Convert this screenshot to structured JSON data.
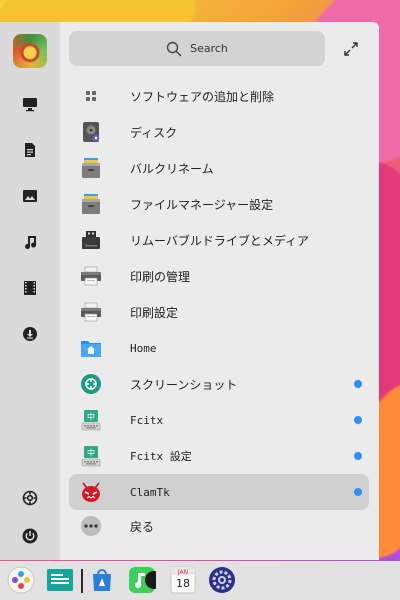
{
  "search": {
    "label": "Search"
  },
  "sidebar": {
    "icons": [
      "computer-icon",
      "document-icon",
      "picture-icon",
      "music-icon",
      "video-icon",
      "download-icon",
      "settings-icon",
      "power-icon"
    ]
  },
  "apps": [
    {
      "label": "ソフトウェアの追加と削除",
      "icon": "package-grid-icon",
      "mono": false,
      "dot": false
    },
    {
      "label": "ディスク",
      "icon": "disk-icon",
      "mono": false,
      "dot": false
    },
    {
      "label": "バルクリネーム",
      "icon": "file-cabinet-icon",
      "mono": false,
      "dot": false
    },
    {
      "label": "ファイルマネージャー設定",
      "icon": "file-cabinet-icon",
      "mono": false,
      "dot": false
    },
    {
      "label": "リムーバブルドライブとメディア",
      "icon": "removable-drive-icon",
      "mono": false,
      "dot": false
    },
    {
      "label": "印刷の管理",
      "icon": "printer-icon",
      "mono": false,
      "dot": false
    },
    {
      "label": "印刷設定",
      "icon": "printer-icon",
      "mono": false,
      "dot": false
    },
    {
      "label": "Home",
      "icon": "home-folder-icon",
      "mono": true,
      "dot": false
    },
    {
      "label": "スクリーンショット",
      "icon": "screenshot-icon",
      "mono": false,
      "dot": true
    },
    {
      "label": "Fcitx",
      "icon": "keyboard-input-icon",
      "mono": true,
      "dot": true
    },
    {
      "label": "Fcitx 設定",
      "icon": "keyboard-input-icon",
      "mono": true,
      "dot": true
    },
    {
      "label": "ClamTk",
      "icon": "clamtk-icon",
      "mono": true,
      "dot": true,
      "selected": true
    }
  ],
  "back": {
    "label": "戻る"
  },
  "dock": {
    "items": [
      "launcher-icon",
      "file-manager-icon",
      "store-icon",
      "music-player-icon",
      "calendar-icon",
      "system-settings-icon"
    ],
    "calendar": {
      "month": "JAN",
      "day": "18"
    }
  },
  "colors": {
    "notify_dot": "#2f8ff2",
    "selected_row": "#d0d0d0"
  }
}
